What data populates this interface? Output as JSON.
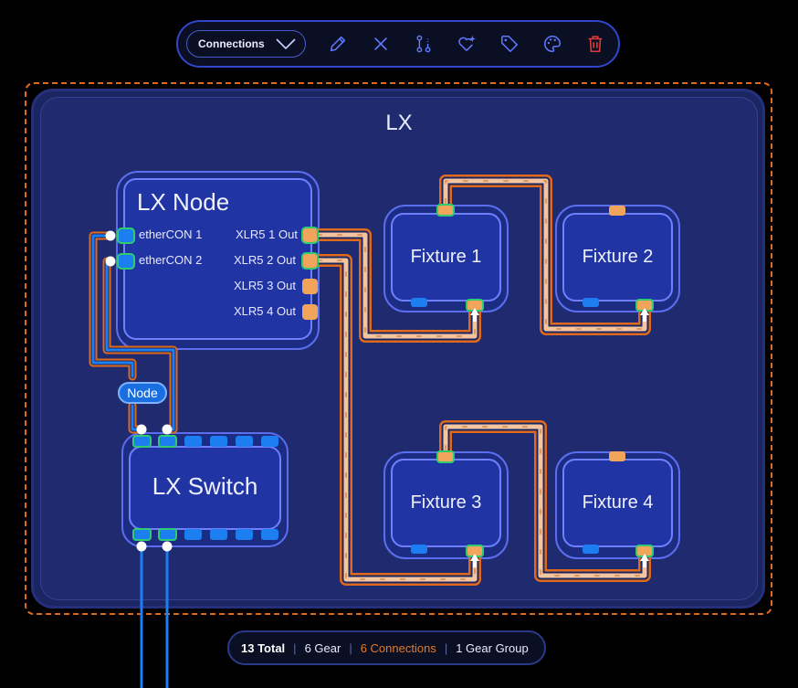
{
  "toolbar": {
    "mode_label": "Connections",
    "tools": [
      {
        "icon": "pencil-icon"
      },
      {
        "icon": "close-icon"
      },
      {
        "icon": "connect-nodes-icon"
      },
      {
        "icon": "heart-sparkle-icon"
      },
      {
        "icon": "tag-icon"
      },
      {
        "icon": "palette-icon"
      },
      {
        "icon": "trash-icon"
      }
    ]
  },
  "group": {
    "title": "LX"
  },
  "gear": {
    "lx_node": {
      "title": "LX Node",
      "inputs": [
        "etherCON 1",
        "etherCON 2"
      ],
      "outputs": [
        "XLR5 1 Out",
        "XLR5 2 Out",
        "XLR5 3 Out",
        "XLR5 4 Out"
      ]
    },
    "lx_switch": {
      "title": "LX Switch"
    },
    "fixtures": [
      "Fixture 1",
      "Fixture 2",
      "Fixture 3",
      "Fixture 4"
    ]
  },
  "node_pill": {
    "label": "Node"
  },
  "status": {
    "total": "13 Total",
    "gear": "6 Gear",
    "connections": "6 Connections",
    "groups": "1 Gear Group"
  },
  "colors": {
    "background": "#000000",
    "accent_blue": "#2f47c8",
    "cable_orange": "#e06a1c",
    "network_blue": "#1c7ef0",
    "danger_red": "#e03a3a"
  }
}
